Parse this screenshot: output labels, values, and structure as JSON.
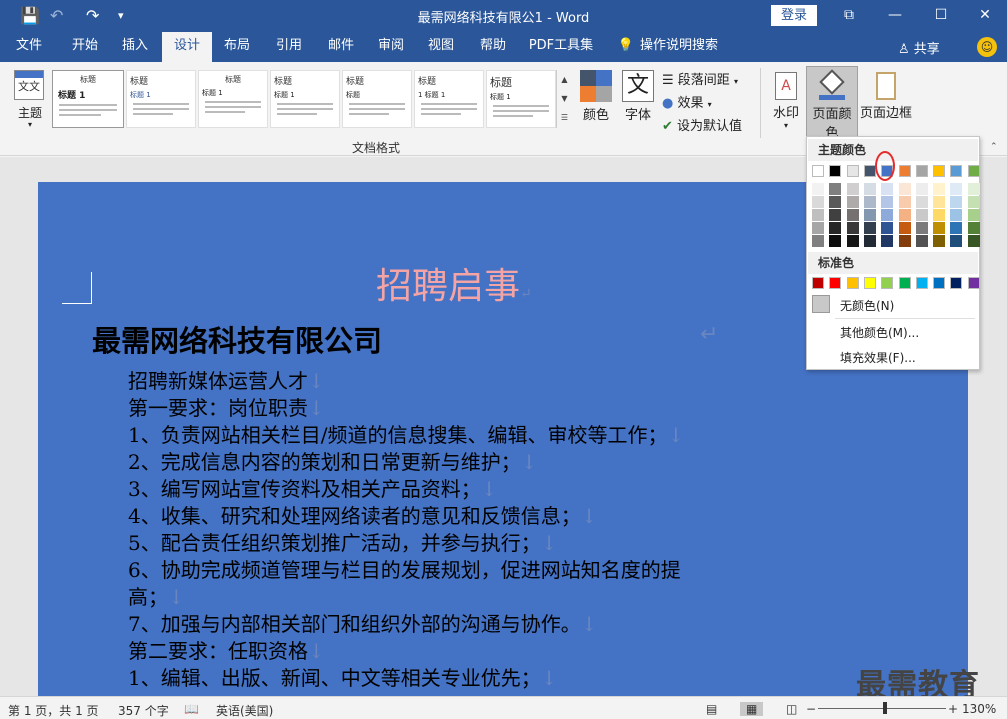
{
  "window": {
    "title": "最需网络科技有限公1  -  Word",
    "login_label": "登录",
    "controls": {
      "restore": "⧉",
      "minimize": "—",
      "maximize": "☐",
      "close": "✕"
    }
  },
  "quick_access": {
    "save": "💾",
    "undo": "↶",
    "redo": "↷",
    "customize": "▾"
  },
  "tabs": [
    {
      "label": "文件"
    },
    {
      "label": "开始"
    },
    {
      "label": "插入"
    },
    {
      "label": "设计"
    },
    {
      "label": "布局"
    },
    {
      "label": "引用"
    },
    {
      "label": "邮件"
    },
    {
      "label": "审阅"
    },
    {
      "label": "视图"
    },
    {
      "label": "帮助"
    },
    {
      "label": "PDF工具集"
    },
    {
      "label": "操作说明搜索"
    }
  ],
  "active_tab": "设计",
  "share_label": "共享",
  "ribbon": {
    "theme_label": "主题",
    "style_thumbs": [
      {
        "title": "标题",
        "heading": "标题 1"
      },
      {
        "title": "标题",
        "heading": "标题 1"
      },
      {
        "title": "标题",
        "heading": "标题 1"
      },
      {
        "title": "标题",
        "heading": "标题 1"
      },
      {
        "title": "标题",
        "heading": "标题"
      },
      {
        "title": "标题",
        "heading": "1 标题 1"
      },
      {
        "title": "标题",
        "heading": "标题 1"
      }
    ],
    "colors_label": "颜色",
    "fonts_label": "字体",
    "font_glyph": "文",
    "paragraph_spacing": "段落间距",
    "effects": "效果",
    "set_default": "设为默认值",
    "group_label": "文档格式",
    "watermark_label": "水印",
    "page_color_label": "页面颜色",
    "page_border_label": "页面边框"
  },
  "document": {
    "title": "招聘启事",
    "company": "最需网络科技有限公司",
    "lines": [
      "招聘新媒体运营人才",
      "第一要求：岗位职责",
      "1、负责网站相关栏目/频道的信息搜集、编辑、审校等工作；",
      "2、完成信息内容的策划和日常更新与维护；",
      "3、编写网站宣传资料及相关产品资料；",
      "4、收集、研究和处理网络读者的意见和反馈信息；",
      "5、配合责任组织策划推广活动，并参与执行；",
      "6、协助完成频道管理与栏目的发展规划，促进网站知名度的提",
      "高；",
      "7、加强与内部相关部门和组织外部的沟通与协作。",
      "第二要求：任职资格",
      "1、编辑、出版、新闻、中文等相关专业优先；"
    ],
    "page_background": "#4472c4"
  },
  "watermark_text": "最需教育",
  "page_color_menu": {
    "theme_colors_heading": "主题颜色",
    "theme_colors": [
      "#ffffff",
      "#000000",
      "#e7e6e6",
      "#44546a",
      "#4472c4",
      "#ed7d31",
      "#a5a5a5",
      "#ffc000",
      "#5b9bd5",
      "#70ad47"
    ],
    "theme_shades": [
      [
        "#f2f2f2",
        "#d9d9d9",
        "#bfbfbf",
        "#a6a6a6",
        "#808080"
      ],
      [
        "#7f7f7f",
        "#595959",
        "#404040",
        "#262626",
        "#0d0d0d"
      ],
      [
        "#d0cece",
        "#aeaaaa",
        "#757171",
        "#3a3838",
        "#171616"
      ],
      [
        "#d6dce4",
        "#adb9ca",
        "#8497b0",
        "#333f4f",
        "#222a35"
      ],
      [
        "#d9e2f3",
        "#b4c6e7",
        "#8eaadb",
        "#2f5496",
        "#1f3864"
      ],
      [
        "#fbe5d5",
        "#f7cbac",
        "#f4b183",
        "#c55a11",
        "#833c0b"
      ],
      [
        "#ededed",
        "#dbdbdb",
        "#c9c9c9",
        "#7b7b7b",
        "#525252"
      ],
      [
        "#fff2cc",
        "#fee599",
        "#ffd965",
        "#bf8f00",
        "#7f6000"
      ],
      [
        "#deebf6",
        "#bdd7ee",
        "#9cc3e5",
        "#2e75b5",
        "#1e4e79"
      ],
      [
        "#e2efd9",
        "#c5e0b3",
        "#a8d08d",
        "#538135",
        "#375623"
      ]
    ],
    "standard_colors_heading": "标准色",
    "standard_colors": [
      "#c00000",
      "#ff0000",
      "#ffc000",
      "#ffff00",
      "#92d050",
      "#00b050",
      "#00b0f0",
      "#0070c0",
      "#002060",
      "#7030a0"
    ],
    "no_color_label": "无颜色(N)",
    "more_colors_label": "其他颜色(M)...",
    "fill_effects_label": "填充效果(F)..."
  },
  "status": {
    "page_info": "第 1 页，共 1 页",
    "word_count": "357 个字",
    "language": "英语(美国)",
    "zoom_minus": "−",
    "zoom_plus": "+",
    "zoom_level": "130%"
  }
}
